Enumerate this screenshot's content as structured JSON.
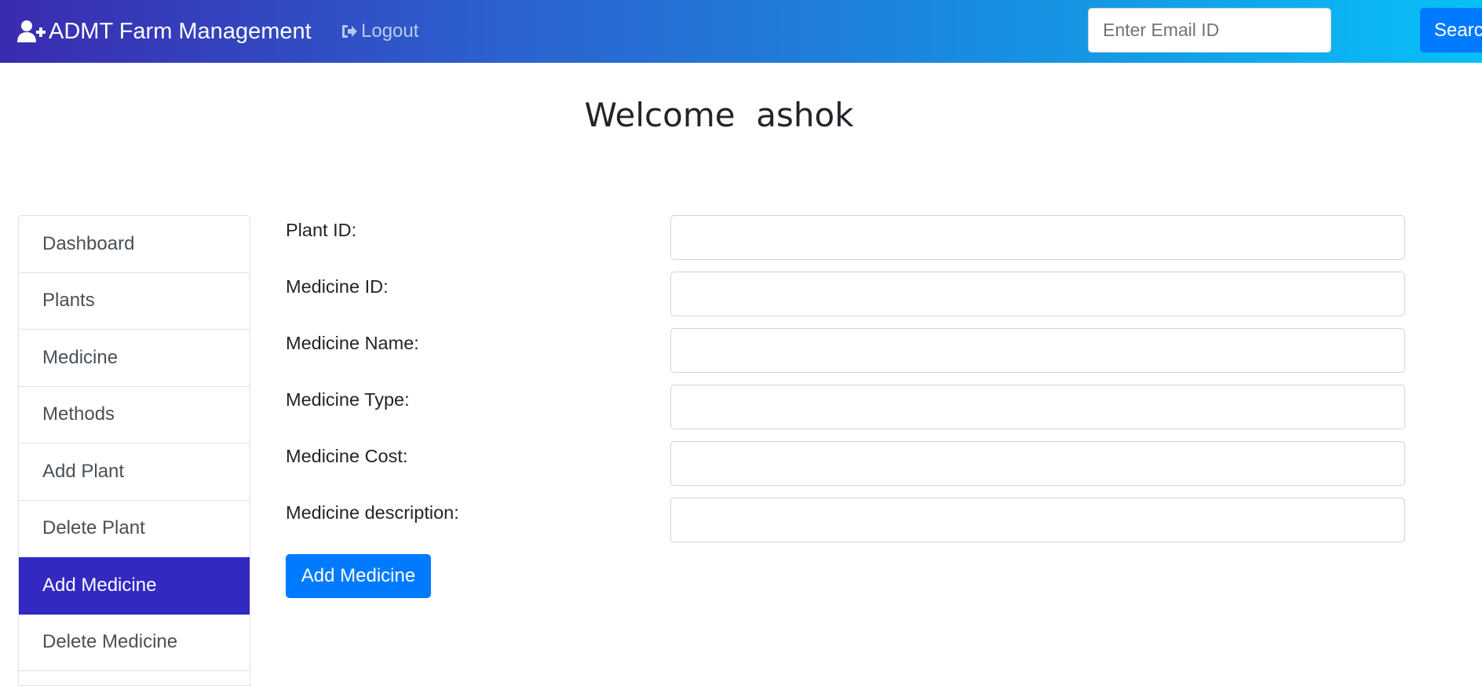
{
  "navbar": {
    "brand": "ADMT Farm Management",
    "brand_icon": "user-plus-icon",
    "logout_label": "Logout",
    "logout_icon": "sign-out-icon",
    "email_placeholder": "Enter Email ID",
    "email_value": "",
    "search_label": "Search",
    "gradient": [
      "#3a2bb0",
      "#2b63cf",
      "#1792e2",
      "#07c0f7"
    ]
  },
  "welcome": {
    "text": "Welcome  ashok"
  },
  "sidebar": {
    "items": [
      {
        "label": "Dashboard"
      },
      {
        "label": "Plants"
      },
      {
        "label": "Medicine"
      },
      {
        "label": "Methods"
      },
      {
        "label": "Add Plant"
      },
      {
        "label": "Delete Plant"
      },
      {
        "label": "Add Medicine"
      },
      {
        "label": "Delete Medicine"
      }
    ],
    "active_label": "Add Medicine",
    "active_color": "#3228c2"
  },
  "form": {
    "fields": [
      {
        "label": "Plant ID:",
        "value": ""
      },
      {
        "label": "Medicine ID:",
        "value": ""
      },
      {
        "label": "Medicine Name:",
        "value": ""
      },
      {
        "label": "Medicine Type:",
        "value": ""
      },
      {
        "label": "Medicine Cost:",
        "value": ""
      },
      {
        "label": "Medicine description:",
        "value": ""
      }
    ],
    "submit_label": "Add Medicine"
  },
  "colors": {
    "primary": "#007bff"
  }
}
